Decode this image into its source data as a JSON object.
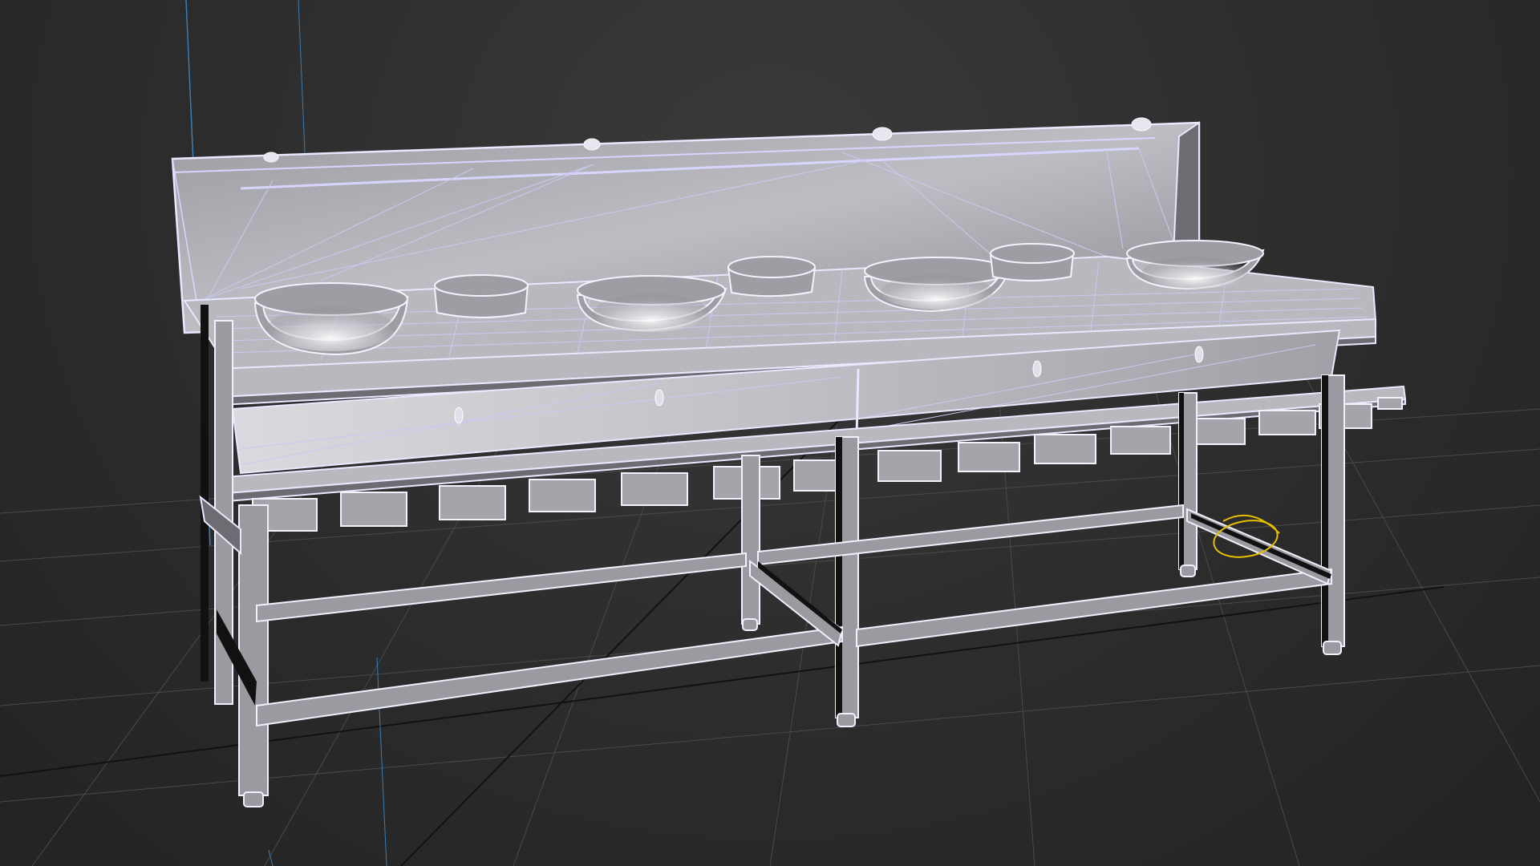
{
  "app": {
    "title": ""
  },
  "viewport": {
    "mode": "wireframe-shaded",
    "background_color": "#2b2b2b",
    "grid_color": "#4a4a4a",
    "wire_color": "#d6d6ff",
    "selection_color": "#e6c000"
  },
  "model": {
    "object": "commercial-stove-with-backsplash",
    "burner_count": 7,
    "tray_count": 15,
    "leg_count": 6
  },
  "icons": {
    "pivot": "pivot-gizmo-icon"
  }
}
